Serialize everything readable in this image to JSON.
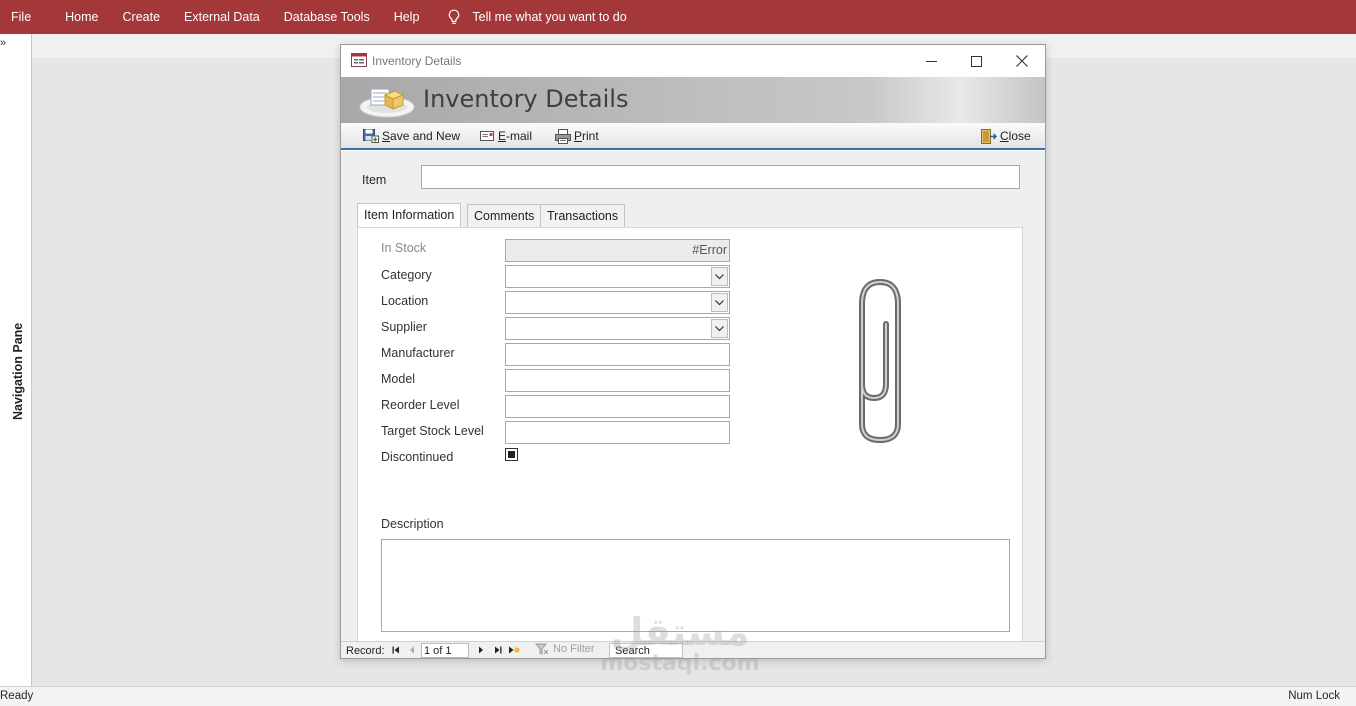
{
  "ribbon": {
    "tabs": [
      "File",
      "Home",
      "Create",
      "External Data",
      "Database Tools",
      "Help"
    ],
    "tell_me": "Tell me what you want to do",
    "background": "#a4373a"
  },
  "nav_pane": {
    "toggle": "»",
    "label": "Navigation Pane"
  },
  "status_bar": {
    "left": "Ready",
    "right": "Num Lock"
  },
  "dialog": {
    "window_title": "Inventory Details",
    "header_title": "Inventory Details",
    "toolbar": {
      "save_and_new": "Save and New",
      "email": "E-mail",
      "print": "Print",
      "close": "Close"
    },
    "item_label": "Item",
    "item_value": "",
    "tabs": [
      "Item Information",
      "Comments",
      "Transactions"
    ],
    "active_tab": "Item Information",
    "fields": {
      "in_stock": {
        "label": "In Stock",
        "value": "#Error"
      },
      "category": {
        "label": "Category",
        "value": ""
      },
      "location": {
        "label": "Location",
        "value": ""
      },
      "supplier": {
        "label": "Supplier",
        "value": ""
      },
      "manufacturer": {
        "label": "Manufacturer",
        "value": ""
      },
      "model": {
        "label": "Model",
        "value": ""
      },
      "reorder_level": {
        "label": "Reorder Level",
        "value": ""
      },
      "target_stock_level": {
        "label": "Target Stock Level",
        "value": ""
      },
      "discontinued": {
        "label": "Discontinued",
        "checked": true
      }
    },
    "description": {
      "label": "Description",
      "value": ""
    },
    "attachment_icon": "paperclip-icon",
    "record_nav": {
      "label": "Record:",
      "current": "1 of 1",
      "filter": "No Filter",
      "search": "Search"
    },
    "accent_color": "#3a6faa"
  },
  "watermark": {
    "arabic": "مستقل",
    "latin": "mostaql.com"
  }
}
